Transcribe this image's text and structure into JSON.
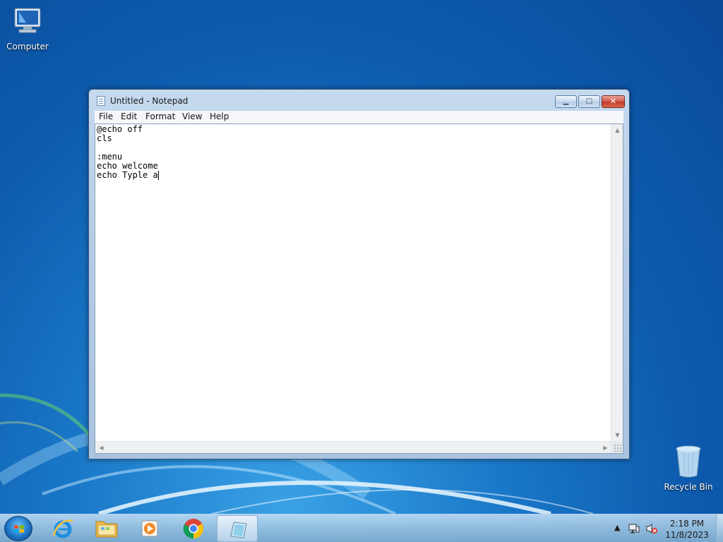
{
  "desktop": {
    "icons": [
      {
        "label": "Computer"
      },
      {
        "label": "Recycle Bin"
      }
    ]
  },
  "window": {
    "title": "Untitled - Notepad",
    "controls": {
      "minimize": "▁",
      "maximize": "□",
      "close": "✕"
    },
    "menu": [
      "File",
      "Edit",
      "Format",
      "View",
      "Help"
    ],
    "text_lines": [
      "@echo off",
      "cls",
      "",
      ":menu",
      "echo welcome",
      "echo Typle a"
    ]
  },
  "taskbar": {
    "apps": [
      {
        "name": "internet-explorer",
        "icon": "ie-icon"
      },
      {
        "name": "windows-explorer",
        "icon": "folder-icon"
      },
      {
        "name": "media-player",
        "icon": "media-player-icon"
      },
      {
        "name": "chrome",
        "icon": "chrome-icon"
      },
      {
        "name": "notepad",
        "icon": "notepad-icon",
        "active": true
      }
    ],
    "clock": {
      "time": "2:18 PM",
      "date": "11/8/2023"
    },
    "tray_icons": [
      "show-hidden-icons-arrow",
      "network-icon",
      "volume-muted-icon"
    ]
  },
  "colors": {
    "accent": "#1a78c8",
    "close_button": "#c03a2b"
  }
}
